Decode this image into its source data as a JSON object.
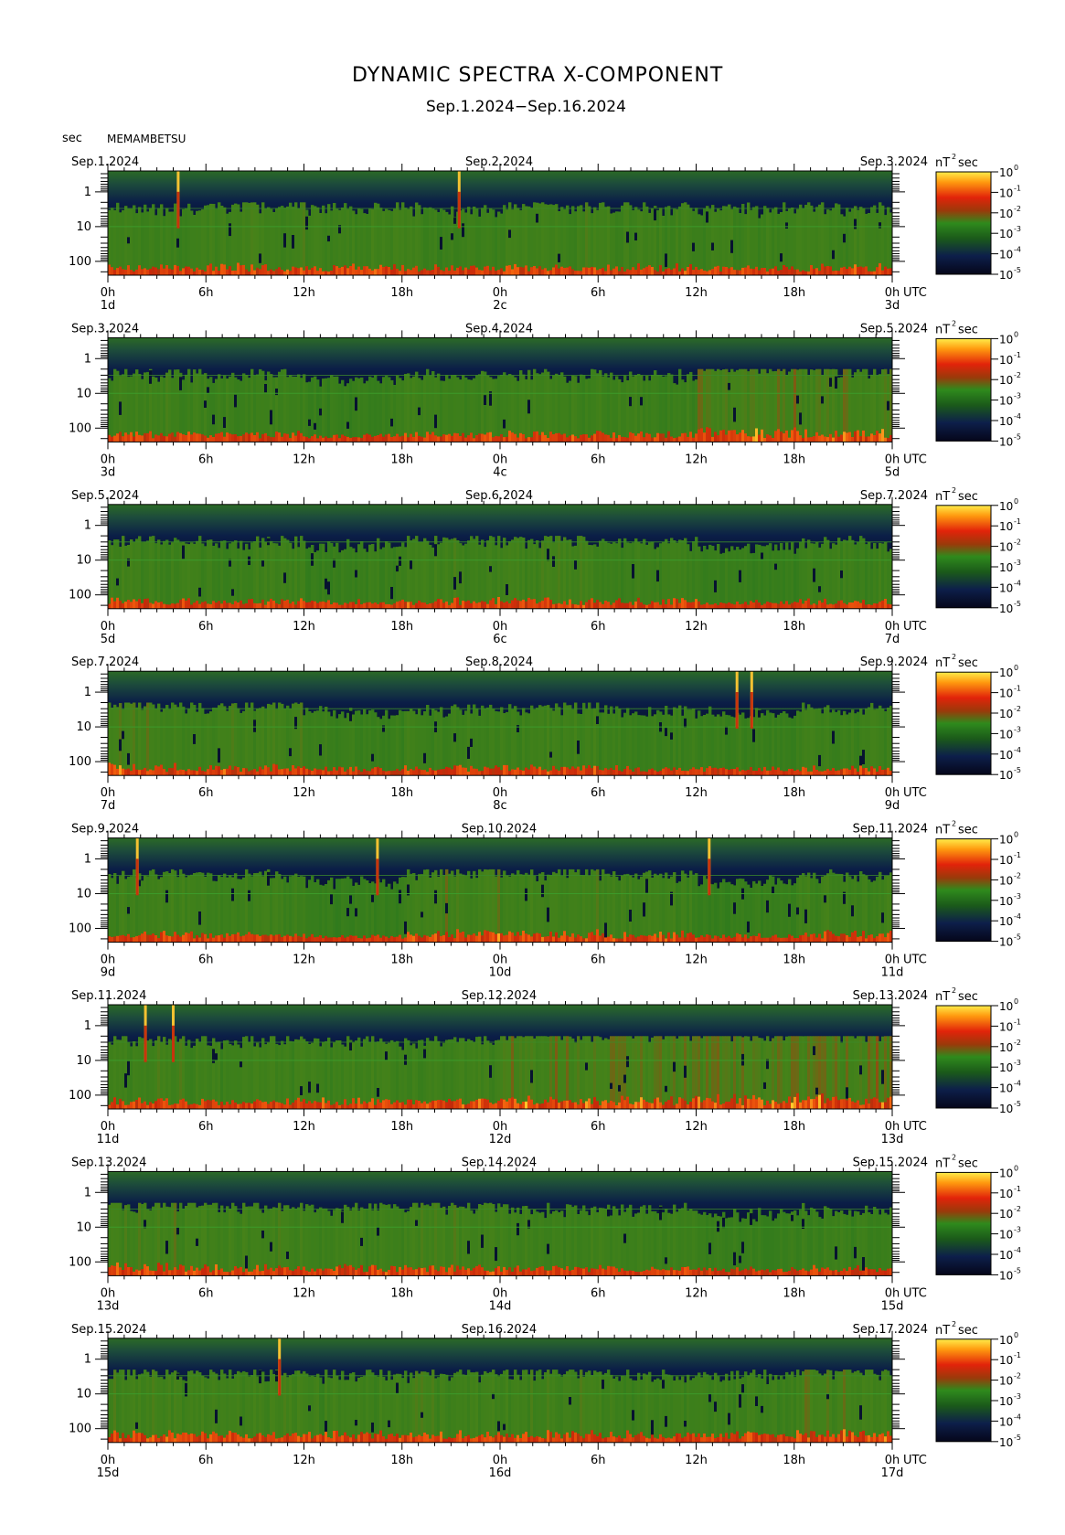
{
  "title": "DYNAMIC SPECTRA X-COMPONENT",
  "subtitle": "Sep.1.2024−Sep.16.2024",
  "station": "MEMAMBETSU",
  "y_unit_label": "sec",
  "colorbar_unit": "nT",
  "colorbar_unit_sec": "sec",
  "colorbar_unit_exp": "2",
  "colorbar_exponents": [
    "0",
    "-1",
    "-2",
    "-3",
    "-4",
    "-5"
  ],
  "colors": {
    "background_low": "#0a0f2a",
    "mid_green": "#2a7a1a",
    "high_red": "#e02a0a",
    "peak_yellow": "#ffe54a"
  },
  "chart_data": {
    "type": "heatmap",
    "y_axis": {
      "label": "sec",
      "scale": "log",
      "ticks": [
        "1",
        "10",
        "100"
      ]
    },
    "x_ticks": [
      "0h",
      "6h",
      "12h",
      "18h",
      "0h",
      "6h",
      "12h",
      "18h",
      "0h"
    ],
    "utc_label": "UTC",
    "colorbar": {
      "label": "nT 2 sec",
      "scale": "log",
      "ticks": [
        "10^0",
        "10^-1",
        "10^-2",
        "10^-3",
        "10^-4",
        "10^-5"
      ]
    },
    "panels": [
      {
        "start_label": "Sep.1.2024",
        "mid_label": "Sep.2.2024",
        "end_label": "Sep.3.2024",
        "day_start": "1d",
        "day_mid": "2c",
        "day_end": "3d",
        "spikes_hours": [
          4.3,
          21.5
        ],
        "base_activity": 0.55,
        "pattern": [
          0.5,
          0.6,
          0.55,
          0.5,
          0.6,
          0.55,
          0.5,
          0.55
        ]
      },
      {
        "start_label": "Sep.3.2024",
        "mid_label": "Sep.4.2024",
        "end_label": "Sep.5.2024",
        "day_start": "3d",
        "day_mid": "4c",
        "day_end": "5d",
        "spikes_hours": [],
        "base_activity": 0.5,
        "pattern": [
          0.55,
          0.5,
          0.35,
          0.5,
          0.55,
          0.5,
          0.8,
          0.7
        ]
      },
      {
        "start_label": "Sep.5.2024",
        "mid_label": "Sep.6.2024",
        "end_label": "Sep.7.2024",
        "day_start": "5d",
        "day_mid": "6c",
        "day_end": "7d",
        "spikes_hours": [],
        "base_activity": 0.5,
        "pattern": [
          0.55,
          0.5,
          0.4,
          0.6,
          0.6,
          0.5,
          0.35,
          0.5
        ]
      },
      {
        "start_label": "Sep.7.2024",
        "mid_label": "Sep.8.2024",
        "end_label": "Sep.9.2024",
        "day_start": "7d",
        "day_mid": "8c",
        "day_end": "9d",
        "spikes_hours": [
          38.5,
          39.4
        ],
        "base_activity": 0.5,
        "pattern": [
          0.65,
          0.6,
          0.4,
          0.5,
          0.55,
          0.45,
          0.4,
          0.5
        ]
      },
      {
        "start_label": "Sep.9.2024",
        "mid_label": "Sep.10.2024",
        "end_label": "Sep.11.2024",
        "day_start": "9d",
        "day_mid": "10d",
        "day_end": "11d",
        "spikes_hours": [
          1.8,
          16.5,
          36.8
        ],
        "base_activity": 0.5,
        "pattern": [
          0.55,
          0.5,
          0.3,
          0.7,
          0.6,
          0.55,
          0.35,
          0.55
        ]
      },
      {
        "start_label": "Sep.11.2024",
        "mid_label": "Sep.12.2024",
        "end_label": "Sep.13.2024",
        "day_start": "11d",
        "day_mid": "12d",
        "day_end": "13d",
        "spikes_hours": [
          2.3,
          4.0
        ],
        "base_activity": 0.6,
        "pattern": [
          0.6,
          0.55,
          0.55,
          0.6,
          0.8,
          0.85,
          0.8,
          0.85
        ]
      },
      {
        "start_label": "Sep.13.2024",
        "mid_label": "Sep.14.2024",
        "end_label": "Sep.15.2024",
        "day_start": "13d",
        "day_mid": "14d",
        "day_end": "15d",
        "spikes_hours": [],
        "base_activity": 0.55,
        "pattern": [
          0.65,
          0.6,
          0.6,
          0.65,
          0.5,
          0.5,
          0.35,
          0.45
        ]
      },
      {
        "start_label": "Sep.15.2024",
        "mid_label": "Sep.16.2024",
        "end_label": "Sep.17.2024",
        "day_start": "15d",
        "day_mid": "16d",
        "day_end": "17d",
        "spikes_hours": [
          10.5
        ],
        "base_activity": 0.55,
        "pattern": [
          0.6,
          0.6,
          0.55,
          0.6,
          0.6,
          0.55,
          0.5,
          0.7
        ]
      }
    ]
  }
}
